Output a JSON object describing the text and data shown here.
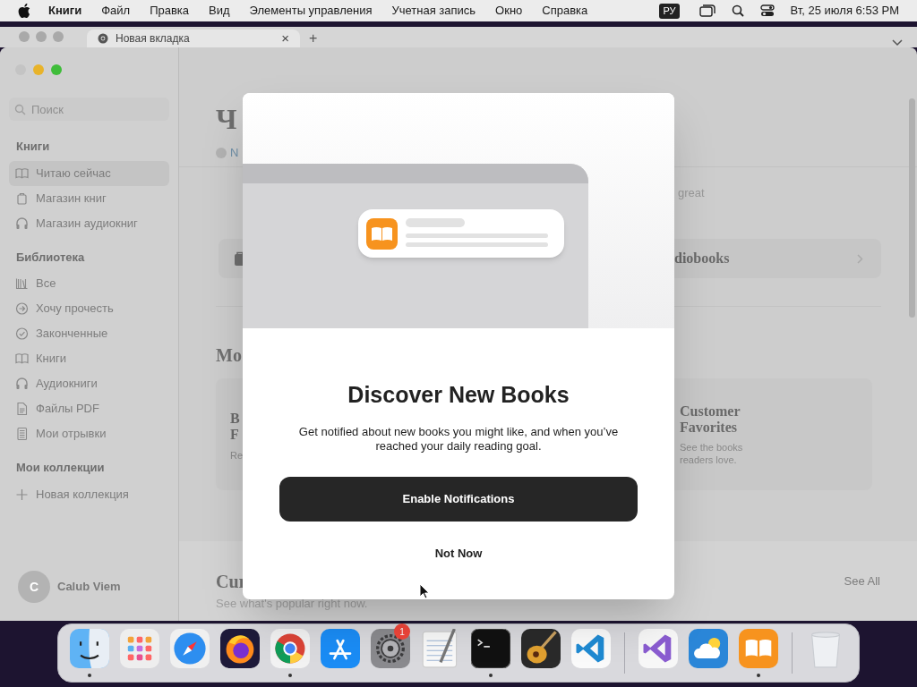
{
  "menu_bar": {
    "app": "Книги",
    "items": [
      "Файл",
      "Правка",
      "Вид",
      "Элементы управления",
      "Учетная запись",
      "Окно",
      "Справка"
    ],
    "input_source": "РУ",
    "datetime": "Вт, 25 июля 6:53 PM"
  },
  "browser": {
    "tab": {
      "title": "Новая вкладка",
      "close": "×"
    },
    "new_tab": "+"
  },
  "sidebar": {
    "search": {
      "placeholder": "Поиск"
    },
    "sections": [
      {
        "title": "Книги",
        "items": [
          {
            "label": "Читаю сейчас",
            "kind": "book",
            "selected": true
          },
          {
            "label": "Магазин книг",
            "kind": "bag",
            "selected": false
          },
          {
            "label": "Магазин аудиокниг",
            "kind": "headphones",
            "selected": false
          }
        ]
      },
      {
        "title": "Библиотека",
        "items": [
          {
            "label": "Все",
            "kind": "shelves",
            "selected": false
          },
          {
            "label": "Хочу прочесть",
            "kind": "arrow",
            "selected": false
          },
          {
            "label": "Законченные",
            "kind": "check",
            "selected": false
          },
          {
            "label": "Книги",
            "kind": "book",
            "selected": false
          },
          {
            "label": "Аудиокниги",
            "kind": "headphones",
            "selected": false
          },
          {
            "label": "Файлы PDF",
            "kind": "doc",
            "selected": false
          },
          {
            "label": "Мои отрывки",
            "kind": "notes",
            "selected": false
          }
        ]
      },
      {
        "title": "Мои коллекции",
        "items": [
          {
            "label": "Новая коллекция",
            "kind": "plus",
            "selected": false
          }
        ]
      }
    ],
    "user": {
      "initial": "C",
      "name": "Calub Viem"
    }
  },
  "main": {
    "title": "Ч",
    "link": "N",
    "goal_text": "great",
    "store_row": "diobooks",
    "section_1": "Mo",
    "card_left": {
      "line_1": "B",
      "line_2": "F",
      "line_3": "Re"
    },
    "card_right": {
      "title": "Customer Favorites",
      "text": "See the books readers love."
    },
    "section_2": {
      "title": "Cur",
      "subtitle": "See what's popular right now.",
      "see_all": "See All"
    }
  },
  "dialog": {
    "title": "Discover New Books",
    "text": "Get notified about new books you might like, and when you’ve reached your daily reading goal.",
    "primary": "Enable Notifications",
    "secondary": "Not Now"
  },
  "dock": {
    "groups": [
      [
        {
          "kind": "finder",
          "running": true
        },
        {
          "kind": "launchpad",
          "running": false
        },
        {
          "kind": "safari",
          "running": false
        },
        {
          "kind": "firefox",
          "running": false
        },
        {
          "kind": "chrome",
          "running": true
        },
        {
          "kind": "appstore",
          "running": false
        },
        {
          "kind": "settings",
          "running": false,
          "badge": "1"
        },
        {
          "kind": "textedit",
          "running": false
        },
        {
          "kind": "terminal",
          "running": true
        },
        {
          "kind": "garageband",
          "running": false
        },
        {
          "kind": "vscode",
          "running": false
        }
      ],
      [
        {
          "kind": "visualstudio",
          "running": false
        },
        {
          "kind": "weather",
          "running": false
        },
        {
          "kind": "books",
          "running": true
        }
      ],
      [
        {
          "kind": "trash",
          "running": false
        }
      ]
    ]
  }
}
